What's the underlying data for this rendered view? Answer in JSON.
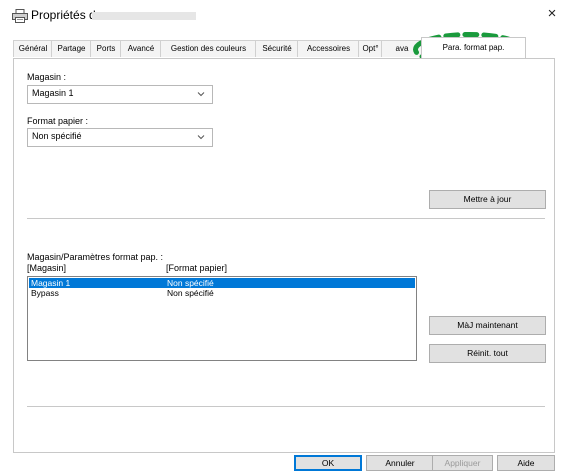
{
  "window": {
    "title": "Propriétés de",
    "close_glyph": "×"
  },
  "tabs": [
    {
      "label": "Général"
    },
    {
      "label": "Partage"
    },
    {
      "label": "Ports"
    },
    {
      "label": "Avancé"
    },
    {
      "label": "Gestion des couleurs"
    },
    {
      "label": "Sécurité"
    },
    {
      "label": "Accessoires"
    },
    {
      "label": "Opt°"
    },
    {
      "label": "ava"
    },
    {
      "label": "Para. format pap."
    }
  ],
  "form": {
    "tray_label": "Magasin :",
    "tray_value": "Magasin 1",
    "paper_label": "Format papier :",
    "paper_value": "Non spécifié",
    "update_button": "Mettre à jour",
    "list_title": "Magasin/Paramètres format pap. :",
    "col_tray": "[Magasin]",
    "col_paper": "[Format papier]",
    "rows": [
      {
        "tray": "Magasin 1",
        "paper": "Non spécifié"
      },
      {
        "tray": "Bypass",
        "paper": "Non spécifié"
      }
    ],
    "update_now_button": "MàJ maintenant",
    "reset_all_button": "Réinit. tout"
  },
  "footer": {
    "ok": "OK",
    "cancel": "Annuler",
    "apply": "Appliquer",
    "help": "Aide"
  },
  "colors": {
    "selection": "#0078d7",
    "highlight_ring": "#1a9a3c"
  }
}
